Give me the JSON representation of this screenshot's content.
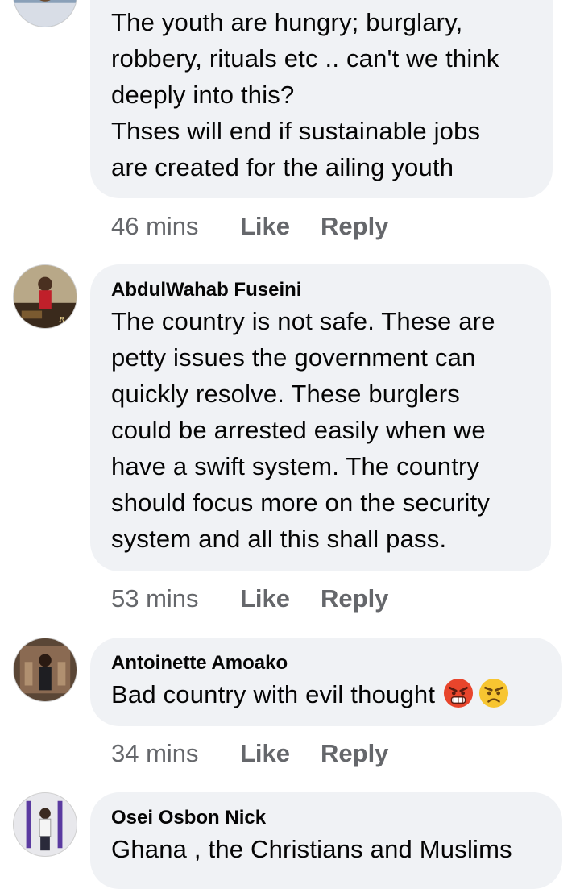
{
  "comments": [
    {
      "author": "",
      "lines": "The youth are hungry; burglary,\nrobbery, rituals etc .. can't we think\ndeeply into this?\nThses will end if sustainable jobs\nare created for the ailing youth",
      "time": "46 mins",
      "like": "Like",
      "reply": "Reply"
    },
    {
      "author": "AbdulWahab Fuseini",
      "lines": "The  country is not safe. These are\npetty issues the government can\nquickly resolve. These burglers\ncould be arrested easily when we\nhave a swift system. The country\nshould focus more on the security\nsystem and all this shall pass.",
      "time": "53 mins",
      "like": "Like",
      "reply": "Reply"
    },
    {
      "author": "Antoinette Amoako",
      "lines": "Bad country with evil thought",
      "emojis": [
        "angry-face-emoji",
        "frowning-angry-face-emoji"
      ],
      "time": "34 mins",
      "like": "Like",
      "reply": "Reply"
    },
    {
      "author": "Osei Osbon Nick",
      "lines": "Ghana , the Christians and Muslims"
    }
  ],
  "colors": {
    "bubble": "#f0f2f5",
    "text": "#050505",
    "meta": "#65676b"
  }
}
